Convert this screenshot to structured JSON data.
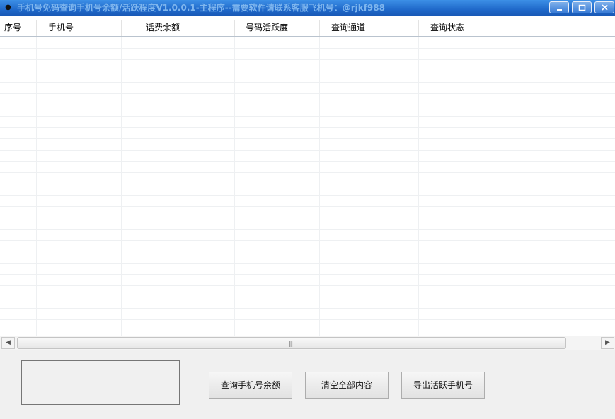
{
  "window": {
    "title": "手机号免码查询手机号余额/活跃程度V1.0.0.1-主程序--需要软件请联系客服飞机号：@rjkf988",
    "icon": "app-icon",
    "controls": {
      "minimize": "minimize-icon",
      "maximize": "maximize-icon",
      "close": "close-icon"
    }
  },
  "table": {
    "columns": [
      "序号",
      "手机号",
      "话费余额",
      "号码活跃度",
      "查询通道",
      "查询状态"
    ],
    "rows": []
  },
  "scrollbar": {
    "left_arrow": "◀",
    "right_arrow": "▶",
    "grip": "|||"
  },
  "buttons": {
    "query": "查询手机号余额",
    "clear": "清空全部内容",
    "export": "导出活跃手机号"
  },
  "colors": {
    "titlebar": "#1f68c9",
    "title_text": "#7fb6ee",
    "background": "#f0f0f0"
  }
}
